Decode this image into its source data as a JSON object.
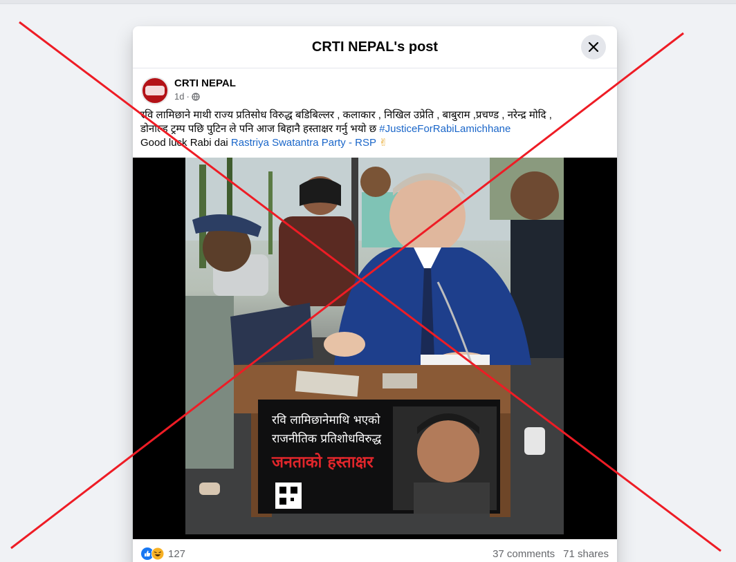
{
  "modal": {
    "title": "CRTI NEPAL's post"
  },
  "post": {
    "author": "CRTI NEPAL",
    "time": "1d",
    "privacy_icon": "globe-icon",
    "text_line1": "रवि लामिछाने माथी राज्य प्रतिसोध विरुद्ध बडिबिल्लर , कलाकार , निखिल उप्रेति , बाबुराम ,प्रचण्ड , नरेन्द्र मोदि ,",
    "text_line2": "डोनाल्ड ट्रम्प पछि पुटिन ले पनि आज बिहानै हस्ताक्षर गर्नु भयो छ ",
    "hashtag": "#JusticeForRabiLamichhane",
    "text_line3": "Good luck Rabi dai ",
    "mention": "Rastriya Swatantra Party - RSP",
    "emoji": "✌"
  },
  "banner": {
    "line1": "रवि लामिछानेमाथि भएको",
    "line2": "राजनीतिक प्रतिशोधविरुद्ध",
    "line3": "जनताको हस्ताक्षर"
  },
  "footer": {
    "reaction_count": "127",
    "comments": "37 comments",
    "shares": "71 shares"
  },
  "colors": {
    "accent_link": "#1a66c9",
    "overlay_cross": "#ee1c25",
    "background": "#f0f2f5"
  }
}
